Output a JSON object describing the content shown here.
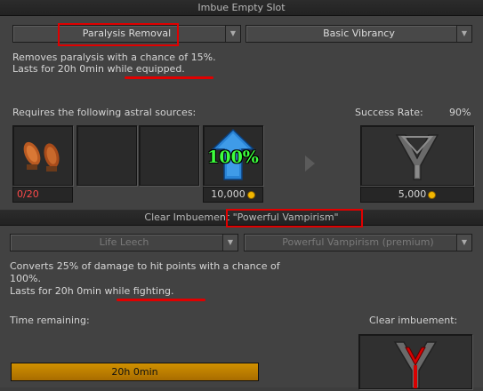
{
  "imbue": {
    "title": "Imbue Empty Slot",
    "type_select": "Paralysis Removal",
    "tier_select": "Basic Vibrancy",
    "description": [
      "Removes paralysis with a chance of 15%.",
      "Lasts for 20h 0min while equipped."
    ],
    "requires_label": "Requires the following astral sources:",
    "success_label": "Success Rate:",
    "success_value": "90%",
    "source_count": "0/20",
    "protection_label": "100%",
    "protection_cost": "10,000",
    "imbue_cost": "5,000"
  },
  "clear": {
    "title_prefix": "Clear Imbuement ",
    "title_name": "\"Powerful Vampirism\"",
    "type_select": "Life Leech",
    "tier_select": "Powerful Vampirism (premium)",
    "description": [
      "Converts 25% of damage to hit points with a chance of",
      "100%.",
      "Lasts for 20h 0min while fighting."
    ],
    "time_label": "Time remaining:",
    "clear_label": "Clear imbuement:",
    "time_value": "20h 0min"
  },
  "colors": {
    "highlight": "#e00000",
    "progress": "#c08400",
    "red_count": "#ff4a4a"
  }
}
